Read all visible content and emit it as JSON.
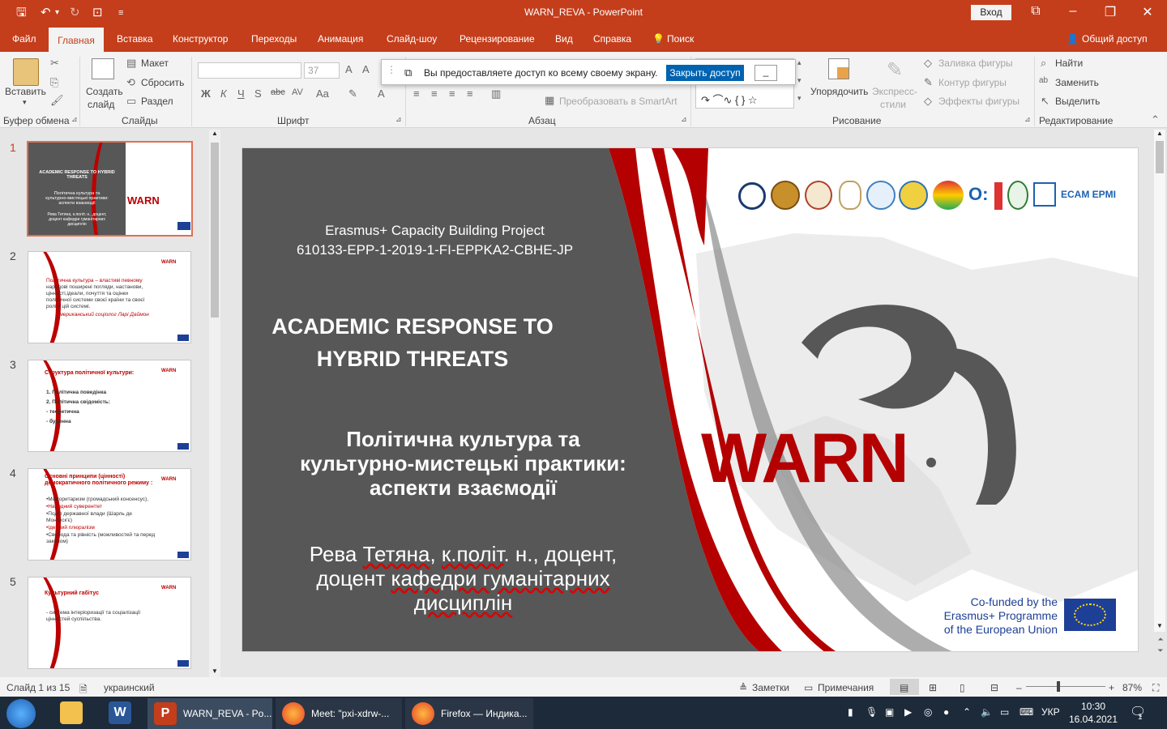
{
  "window": {
    "title": "WARN_REVA  -  PowerPoint",
    "login": "Вход"
  },
  "tabs": [
    "Файл",
    "Главная",
    "Вставка",
    "Конструктор",
    "Переходы",
    "Анимация",
    "Слайд-шоу",
    "Рецензирование",
    "Вид",
    "Справка",
    "Поиск"
  ],
  "share": "Общий доступ",
  "ribbon": {
    "paste": "Вставить",
    "clipboard": "Буфер обмена",
    "create_slide": "Создать",
    "create_slide2": "слайд",
    "layout": "Макет",
    "reset": "Сбросить",
    "section": "Раздел",
    "slides": "Слайды",
    "font_size": "37",
    "font_group": "Шрифт",
    "paragraph": "Абзац",
    "smartart": "Преобразовать в SmartArt",
    "arrange": "Упорядочить",
    "express1": "Экспресс-",
    "express2": "стили",
    "fill": "Заливка фигуры",
    "outline": "Контур фигуры",
    "effects": "Эффекты фигуры",
    "drawing": "Рисование",
    "find": "Найти",
    "replace": "Заменить",
    "select": "Выделить",
    "editing": "Редактирование"
  },
  "banner": {
    "text": "Вы предоставляете доступ ко всему своему экрану.",
    "button": "Закрыть доступ"
  },
  "thumbs": [
    {
      "num": "1",
      "title": "ACADEMIC RESPONSE TO HYBRID THREATS",
      "lines": [
        "Політична культура та",
        "культурно-мистецькі практики:",
        "аспекти взаємодії",
        "Рева Тетяна, к.політ. н., доцент,",
        "доцент кафедри гуманітарних",
        "дисциплін"
      ]
    },
    {
      "num": "2",
      "lines": [
        "Політична культура – властиві певному",
        "народові поширені погляди, настанови,",
        "цінності,ідеали, почуття та оцінки",
        "політичної системи своєї країни та своєї",
        "ролі в цій системі.",
        "Американський соціолог Ларі Даймон"
      ]
    },
    {
      "num": "3",
      "title": "Структура політичної культури:",
      "lines": [
        "1.  Політична поведінка",
        "2.  Політична свідомість:",
        "- теоретична",
        "- буденна"
      ]
    },
    {
      "num": "4",
      "title": "Основні принципи (цінності)",
      "title2": "демократичного політичного режиму :",
      "lines": [
        "•Мажоритаризм (громадський консенсус),",
        "•Народний суверенітет",
        "•Поділ державної влади (Шарль де",
        "  Монтеск'є)",
        "•Ідейний плюралізм",
        "•Свобода та рівність (можливостей та перед",
        "  законом)"
      ]
    },
    {
      "num": "5",
      "title": "Культурний габітус",
      "lines": [
        "-   система інтеріоризації та соціалізації",
        "    цінностей суспільства."
      ]
    }
  ],
  "slide": {
    "project1": "Erasmus+ Capacity Building Project",
    "project2": "610133-EPP-1-2019-1-FI-EPPKA2-CBHE-JP",
    "title1": "ACADEMIC RESPONSE TO",
    "title2": "HYBRID THREATS",
    "sub1": "Політична культура та",
    "sub2": "культурно-мистецькі практики:",
    "sub3": "аспекти взаємодії",
    "author1a": "Рева ",
    "author1b": "Тетяна",
    "author1c": ", ",
    "author1d": "к.політ",
    "author1e": ". н., доцент,",
    "author2a": "доцент ",
    "author2b": "кафедри гуманітарних",
    "author3": "дисциплін",
    "logo": "WARN",
    "cofund1": "Co-funded by the",
    "cofund2": "Erasmus+ Programme",
    "cofund3": "of the European Union",
    "ecam": "ECAM EPMI"
  },
  "status": {
    "slide": "Слайд 1 из 15",
    "lang": "украинский",
    "notes": "Заметки",
    "comments": "Примечания",
    "zoom": "87%"
  },
  "taskbar": {
    "apps": [
      "WARN_REVA - Po...",
      "Meet: \"pxi-xdrw-...",
      "Firefox — Индика..."
    ],
    "lang": "УКР",
    "time": "10:30",
    "date": "16.04.2021",
    "badge": "1"
  }
}
